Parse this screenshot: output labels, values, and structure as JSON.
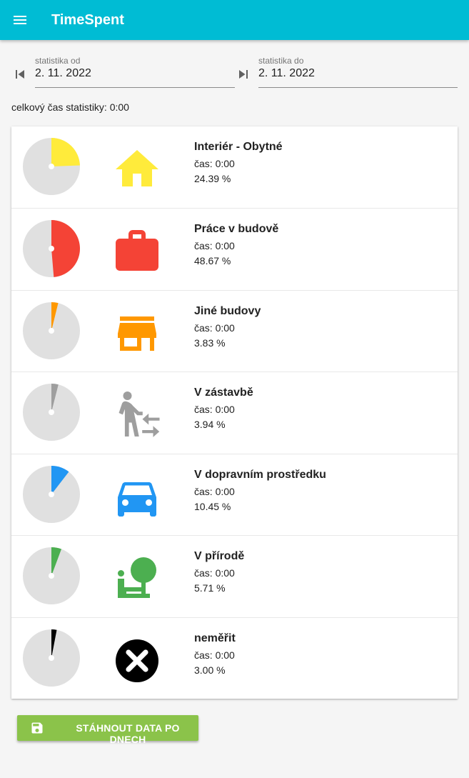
{
  "app": {
    "title": "TimeSpent",
    "menu_icon": "menu-icon"
  },
  "date_range": {
    "from_label": "statistika od",
    "from_value": "2. 11. 2022",
    "to_label": "statistika do",
    "to_value": "2. 11. 2022",
    "prev_icon": "skip-previous-icon",
    "next_icon": "skip-next-icon"
  },
  "total": {
    "text": "celkový čas statistiky: 0:00"
  },
  "categories": [
    {
      "title": "Interiér - Obytné",
      "time": "čas: 0:00",
      "percent_text": "24.39 %",
      "percent": 24.39,
      "color": "#ffeb3b",
      "icon": "home-icon"
    },
    {
      "title": "Práce v budově",
      "time": "čas: 0:00",
      "percent_text": "48.67 %",
      "percent": 48.67,
      "color": "#f44336",
      "icon": "briefcase-icon"
    },
    {
      "title": "Jiné budovy",
      "time": "čas: 0:00",
      "percent_text": "3.83 %",
      "percent": 3.83,
      "color": "#ff9800",
      "icon": "store-icon"
    },
    {
      "title": "V zástavbě",
      "time": "čas: 0:00",
      "percent_text": "3.94 %",
      "percent": 3.94,
      "color": "#9e9e9e",
      "icon": "walking-person-icon"
    },
    {
      "title": "V dopravním prostředku",
      "time": "čas: 0:00",
      "percent_text": "10.45 %",
      "percent": 10.45,
      "color": "#2196f3",
      "icon": "car-icon"
    },
    {
      "title": "V přírodě",
      "time": "čas: 0:00",
      "percent_text": "5.71 %",
      "percent": 5.71,
      "color": "#4caf50",
      "icon": "nature-person-icon"
    },
    {
      "title": "neměřit",
      "time": "čas: 0:00",
      "percent_text": "3.00 %",
      "percent": 3.0,
      "color": "#000000",
      "icon": "cancel-icon"
    }
  ],
  "download": {
    "label": "STÁHNOUT DATA PO DNECH",
    "icon": "save-icon",
    "color": "#8bc34a"
  },
  "colors": {
    "appbar": "#00bcd4",
    "pie_background": "#e0e0e0"
  }
}
